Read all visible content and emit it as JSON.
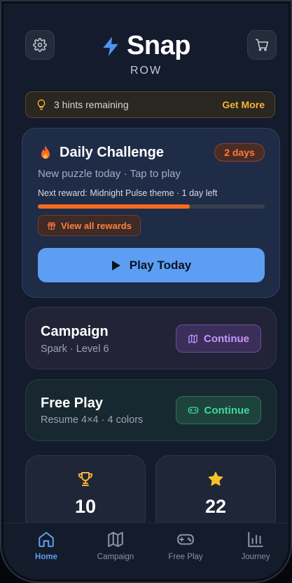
{
  "app": {
    "title": "Snap",
    "subtitle": "ROW"
  },
  "hint": {
    "text": "3 hints remaining",
    "action": "Get More"
  },
  "daily": {
    "title": "Daily Challenge",
    "badge": "2 days",
    "subtitle": "New puzzle today · Tap to play",
    "reward_text": "Next reward: Midnight Pulse theme · 1 day left",
    "progress_fraction": 0.67,
    "rewards_button": "View all rewards",
    "play_button": "Play Today"
  },
  "campaign": {
    "title": "Campaign",
    "subtitle": "Spark · Level 6",
    "button": "Continue"
  },
  "freeplay": {
    "title": "Free Play",
    "subtitle": "Resume 4×4 · 4 colors",
    "button": "Continue"
  },
  "stats": [
    {
      "icon": "trophy-icon",
      "value": "10"
    },
    {
      "icon": "star-icon",
      "value": "22"
    }
  ],
  "tabs": [
    {
      "label": "Home",
      "icon": "home-icon",
      "active": true
    },
    {
      "label": "Campaign",
      "icon": "map-icon",
      "active": false
    },
    {
      "label": "Free Play",
      "icon": "gamepad-icon",
      "active": false
    },
    {
      "label": "Journey",
      "icon": "bar-chart-icon",
      "active": false
    }
  ],
  "colors": {
    "accent": "#5d9ef2",
    "streak": "#ff7a3d",
    "hint": "#f5b335",
    "campaign": "#c795ff",
    "freeplay": "#3fd999"
  }
}
